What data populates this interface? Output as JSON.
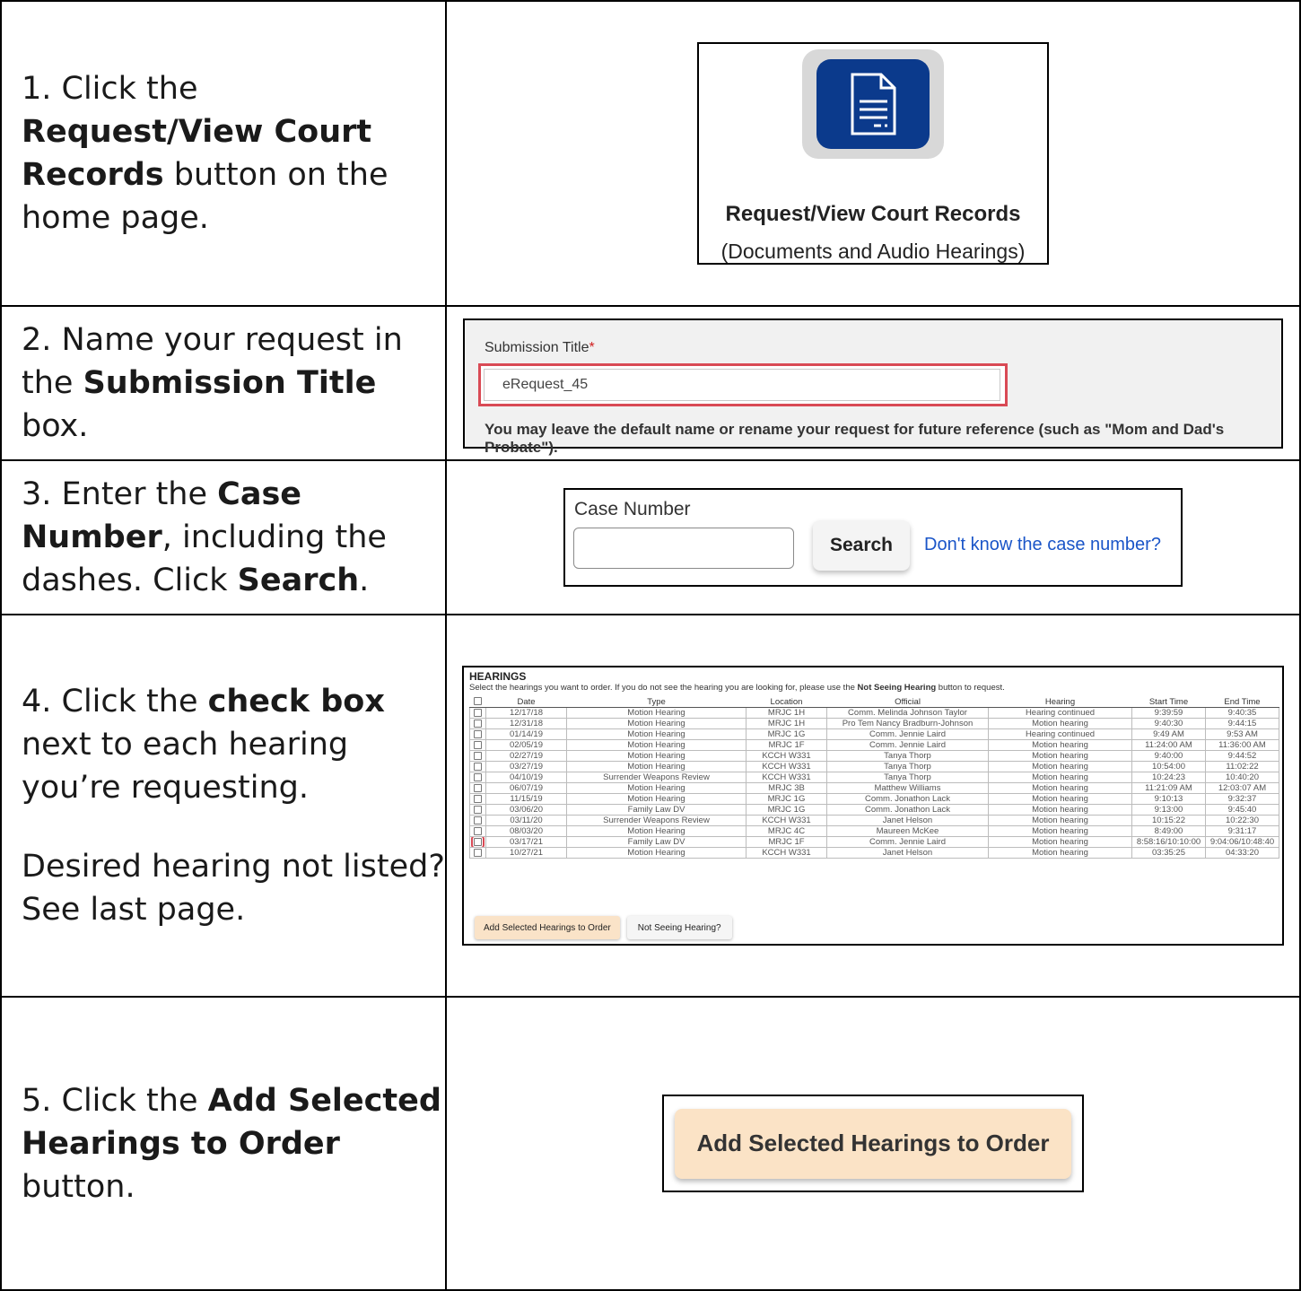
{
  "steps": [
    {
      "pre": "1.  Click the ",
      "bold": "Request/View Court Records",
      "post": " button on the home page."
    },
    {
      "pre": "2.  Name your request in the ",
      "bold": "Submission Title",
      "post": " box."
    },
    {
      "pre": "3.  Enter the ",
      "bold": "Case Number",
      "mid": ", including the dashes. Click ",
      "bold2": "Search",
      "post": "."
    },
    {
      "pre": "4.  Click the ",
      "bold": "check box",
      "post": " next to each hearing you’re requesting.",
      "extra": "Desired hearing not listed? See last page."
    },
    {
      "pre": "5.  Click the ",
      "bold": "Add Selected Hearings to Order",
      "post": " button."
    }
  ],
  "shot1": {
    "icon": "document-icon",
    "title": "Request/View Court Records",
    "subtitle": "(Documents and Audio Hearings)",
    "colors": {
      "tile_bg": "#d8d8d8",
      "icon_bg": "#0b3a8c"
    }
  },
  "shot2": {
    "label": "Submission Title",
    "required_mark": "*",
    "value": "eRequest_45",
    "hint": "You may leave the default name or rename your request for future reference (such as \"Mom and Dad's Probate\").",
    "highlight_color": "#d94a55"
  },
  "shot3": {
    "label": "Case Number",
    "search_label": "Search",
    "link_text": "Don't know the case number?",
    "link_color": "#1a55c8"
  },
  "shot4": {
    "title": "HEARINGS",
    "desc_pre": "Select the hearings you want to order. If you do not see the hearing you are looking for, please use the ",
    "desc_bold": "Not Seeing Hearing",
    "desc_post": " button to request.",
    "columns": [
      "Date",
      "Type",
      "Location",
      "Official",
      "Hearing",
      "Start Time",
      "End Time"
    ],
    "rows": [
      [
        "12/17/18",
        "Motion Hearing",
        "MRJC 1H",
        "Comm. Melinda Johnson Taylor",
        "Hearing continued",
        "9:39:59",
        "9:40:35"
      ],
      [
        "12/31/18",
        "Motion Hearing",
        "MRJC 1H",
        "Pro Tem Nancy Bradburn-Johnson",
        "Motion hearing",
        "9:40:30",
        "9:44:15"
      ],
      [
        "01/14/19",
        "Motion Hearing",
        "MRJC 1G",
        "Comm. Jennie Laird",
        "Hearing continued",
        "9:49 AM",
        "9:53 AM"
      ],
      [
        "02/05/19",
        "Motion Hearing",
        "MRJC 1F",
        "Comm. Jennie Laird",
        "Motion hearing",
        "11:24:00 AM",
        "11:36:00 AM"
      ],
      [
        "02/27/19",
        "Motion Hearing",
        "KCCH W331",
        "Tanya Thorp",
        "Motion hearing",
        "9:40:00",
        "9:44:52"
      ],
      [
        "03/27/19",
        "Motion Hearing",
        "KCCH W331",
        "Tanya Thorp",
        "Motion hearing",
        "10:54:00",
        "11:02:22"
      ],
      [
        "04/10/19",
        "Surrender Weapons Review",
        "KCCH W331",
        "Tanya Thorp",
        "Motion hearing",
        "10:24:23",
        "10:40:20"
      ],
      [
        "06/07/19",
        "Motion Hearing",
        "MRJC 3B",
        "Matthew Williams",
        "Motion hearing",
        "11:21:09 AM",
        "12:03:07 AM"
      ],
      [
        "11/15/19",
        "Motion Hearing",
        "MRJC 1G",
        "Comm. Jonathon Lack",
        "Motion hearing",
        "9:10:13",
        "9:32:37"
      ],
      [
        "03/06/20",
        "Family Law DV",
        "MRJC 1G",
        "Comm. Jonathon Lack",
        "Motion hearing",
        "9:13:00",
        "9:45:40"
      ],
      [
        "03/11/20",
        "Surrender Weapons Review",
        "KCCH W331",
        "Janet Helson",
        "Motion hearing",
        "10:15:22",
        "10:22:30"
      ],
      [
        "08/03/20",
        "Motion Hearing",
        "MRJC 4C",
        "Maureen McKee",
        "Motion hearing",
        "8:49:00",
        "9:31:17"
      ],
      [
        "03/17/21",
        "Family Law DV",
        "MRJC 1F",
        "Comm. Jennie Laird",
        "Motion hearing",
        "8:58:16/10:10:00",
        "9:04:06/10:48:40"
      ],
      [
        "10/27/21",
        "Motion Hearing",
        "KCCH W331",
        "Janet Helson",
        "Motion hearing",
        "03:35:25",
        "04:33:20"
      ]
    ],
    "highlighted_row": 12,
    "add_button": "Add Selected Hearings to Order",
    "not_seeing_button": "Not Seeing Hearing?"
  },
  "shot5": {
    "button": "Add Selected Hearings to Order",
    "color": "#fbe3c6"
  }
}
